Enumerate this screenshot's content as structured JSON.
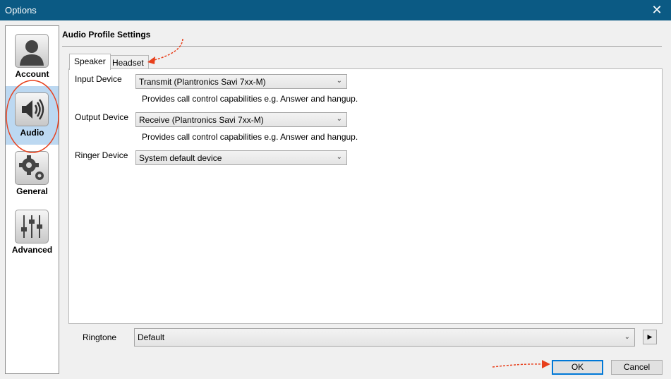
{
  "window": {
    "title": "Options",
    "close_glyph": "✕"
  },
  "sidebar": {
    "items": [
      {
        "label": "Account",
        "icon": "person-icon",
        "selected": false
      },
      {
        "label": "Audio",
        "icon": "speaker-icon",
        "selected": true
      },
      {
        "label": "General",
        "icon": "gears-icon",
        "selected": false
      },
      {
        "label": "Advanced",
        "icon": "sliders-icon",
        "selected": false
      }
    ]
  },
  "main": {
    "section_title": "Audio Profile Settings",
    "tabs": [
      {
        "label": "Speaker",
        "active": true
      },
      {
        "label": "Headset",
        "active": false
      }
    ],
    "input_device": {
      "label": "Input Device",
      "value": "Transmit (Plantronics Savi 7xx-M)",
      "hint": "Provides call control capabilities e.g. Answer and hangup."
    },
    "output_device": {
      "label": "Output Device",
      "value": "Receive (Plantronics Savi 7xx-M)",
      "hint": "Provides call control capabilities e.g. Answer and hangup."
    },
    "ringer_device": {
      "label": "Ringer Device",
      "value": "System default device"
    },
    "ringtone": {
      "label": "Ringtone",
      "value": "Default",
      "play_glyph": "▶"
    }
  },
  "footer": {
    "ok_label": "OK",
    "cancel_label": "Cancel"
  },
  "colors": {
    "titlebar": "#0b5a84",
    "selected": "#bcd8f1",
    "annotation": "#e8401c"
  }
}
